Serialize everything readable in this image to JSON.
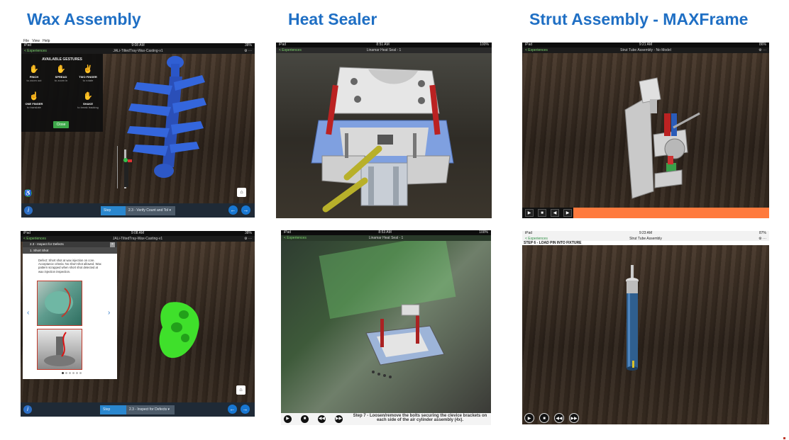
{
  "columns": [
    {
      "title": "Wax Assembly"
    },
    {
      "title": "Heat Sealer"
    },
    {
      "title": "Strut Assembly - MAXFrame"
    }
  ],
  "wax_top": {
    "menu": [
      "File",
      "View",
      "Help"
    ],
    "status_left": "iPad",
    "status_time": "9:08 AM",
    "status_right": "38%",
    "back_label": "< Experiences",
    "nav_title": "JALi-TiltedTray-Wax-Casting-v1",
    "gestures_title": "AVAILABLE GESTURES",
    "gestures": [
      {
        "icon": "pinch-gesture-icon",
        "name": "PINCH",
        "desc": "to zoom out"
      },
      {
        "icon": "spread-gesture-icon",
        "name": "SPREAD",
        "desc": "to zoom in"
      },
      {
        "icon": "two-finger-gesture-icon",
        "name": "TWO FINGER",
        "desc": "to rotate"
      },
      {
        "icon": "one-finger-gesture-icon",
        "name": "ONE FINGER",
        "desc": "to translate"
      },
      {
        "icon": "shake-gesture-icon",
        "name": "SHAKE",
        "desc": "to break tracking"
      }
    ],
    "close_label": "Close",
    "step_left": "Step",
    "step_right": "2.3 - Verify Count and Tol"
  },
  "wax_bottom": {
    "status_left": "iPad",
    "status_time": "9:08 AM",
    "status_right": "38%",
    "back_label": "< Experiences",
    "nav_title": "JALi-TiltedTray-Wax-Casting-v1",
    "panel_header": "2.3 - Inspect for Defects",
    "panel_sub": "1. Short Shot",
    "defect_text": "Defect: Short shot at wax injection on core. Acceptance criteria: No short shot allowed. Wax pattern scrapped when short shot detected at wax injection inspection.",
    "step_left": "Step",
    "step_right": "2.3 - Inspect for Defects"
  },
  "heat_top": {
    "status_left": "iPad",
    "status_time": "8:51 AM",
    "status_right": "100%",
    "back_label": "< Experiences",
    "nav_title": "Linamar Heat Seal - 1"
  },
  "heat_bottom": {
    "status_left": "iPad",
    "status_time": "8:53 AM",
    "status_right": "100%",
    "back_label": "< Experiences",
    "nav_title": "Linamar Heat Seal - 1",
    "caption": "Step 7 - Loosen/remove the bolts securing the clevice brackets on each side of the air cylinder assembly (4x)."
  },
  "strut_top": {
    "status_left": "iPad",
    "status_time": "9:21 AM",
    "status_right": "86%",
    "back_label": "< Experiences",
    "nav_title": "Strut Tube Assembly - No Model"
  },
  "strut_bottom": {
    "status_left": "iPad",
    "status_time": "9:23 AM",
    "status_right": "87%",
    "back_label": "< Experiences",
    "nav_title": "Strut Tube Assembly",
    "step_title": "STEP 6 - LOAD PIN INTO FIXTURE"
  },
  "colors": {
    "title_blue": "#1f6fc4",
    "model_blue": "#2a56c8",
    "accent_green": "#3ea84a",
    "orange_bar": "#ff7a3d"
  }
}
